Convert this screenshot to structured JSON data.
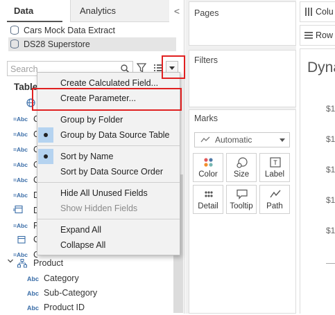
{
  "data_pane": {
    "tab_data": "Data",
    "tab_analytics": "Analytics",
    "collapse_glyph": "<",
    "data_sources": [
      "Cars Mock Data Extract",
      "DS28 Superstore"
    ],
    "search_placeholder": "Search",
    "tables_heading": "Table",
    "product_folder": "Product",
    "product_fields": [
      "Category",
      "Sub-Category",
      "Product ID"
    ]
  },
  "context_menu": {
    "items": [
      {
        "label": "Create Calculated Field...",
        "checked": false,
        "enabled": true
      },
      {
        "label": "Create Parameter...",
        "checked": false,
        "enabled": true
      },
      {
        "label": "Group by Folder",
        "checked": false,
        "enabled": true
      },
      {
        "label": "Group by Data Source Table",
        "checked": true,
        "enabled": true
      },
      {
        "label": "Sort by Name",
        "checked": true,
        "enabled": true
      },
      {
        "label": "Sort by Data Source Order",
        "checked": false,
        "enabled": true
      },
      {
        "label": "Hide All Unused Fields",
        "checked": false,
        "enabled": true
      },
      {
        "label": "Show Hidden Fields",
        "checked": false,
        "enabled": false
      },
      {
        "label": "Expand All",
        "checked": false,
        "enabled": true
      },
      {
        "label": "Collapse All",
        "checked": false,
        "enabled": true
      }
    ]
  },
  "shelves": {
    "pages": "Pages",
    "filters": "Filters",
    "marks": "Marks",
    "mark_type": "Automatic",
    "mark_buttons": [
      "Color",
      "Size",
      "Label",
      "Detail",
      "Tooltip",
      "Path"
    ],
    "columns": "Colu",
    "rows": "Row"
  },
  "view": {
    "title": "Dyna",
    "axis_ticks": [
      "$1",
      "$1",
      "$1",
      "$1",
      "$1"
    ]
  },
  "colors": {
    "highlight": "#e02020",
    "field_icon": "#3b6ea8",
    "menu_bg": "#f2f2f2",
    "check_bg": "#b5d3f0"
  }
}
